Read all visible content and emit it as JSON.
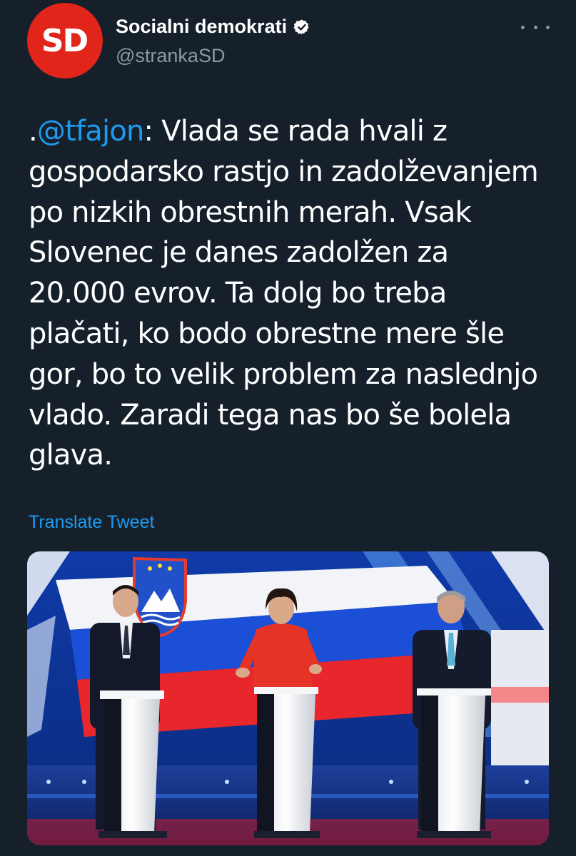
{
  "account": {
    "avatar_text": "SD",
    "display_name": "Socialni demokrati",
    "handle": "@strankaSD",
    "verified_icon": "verified-badge-icon"
  },
  "menu": {
    "more_icon": "more-options-icon"
  },
  "tweet": {
    "lines": [
      {
        "prefix": ".",
        "mention": "@tfajon",
        "rest": ": Vlada se rada hvali z"
      },
      {
        "text": "gospodarsko rastjo in zadolževanjem"
      },
      {
        "text": "po nizkih obrestnih merah. Vsak"
      },
      {
        "text": "Slovenec je danes zadolžen za"
      },
      {
        "text": "20.000 evrov. Ta dolg bo treba"
      },
      {
        "text": "plačati, ko bodo obrestne mere šle"
      },
      {
        "text": "gor, bo to velik problem za naslednjo"
      },
      {
        "text": "vlado. Zaradi tega nas bo še bolela"
      },
      {
        "text": "glava."
      }
    ]
  },
  "translate_label": "Translate Tweet",
  "colors": {
    "background": "#15202b",
    "accent": "#1d9bf0",
    "secondary_text": "#8b98a5",
    "avatar_red": "#e1251b"
  },
  "media": {
    "description_icon": "tv-debate-photo"
  }
}
